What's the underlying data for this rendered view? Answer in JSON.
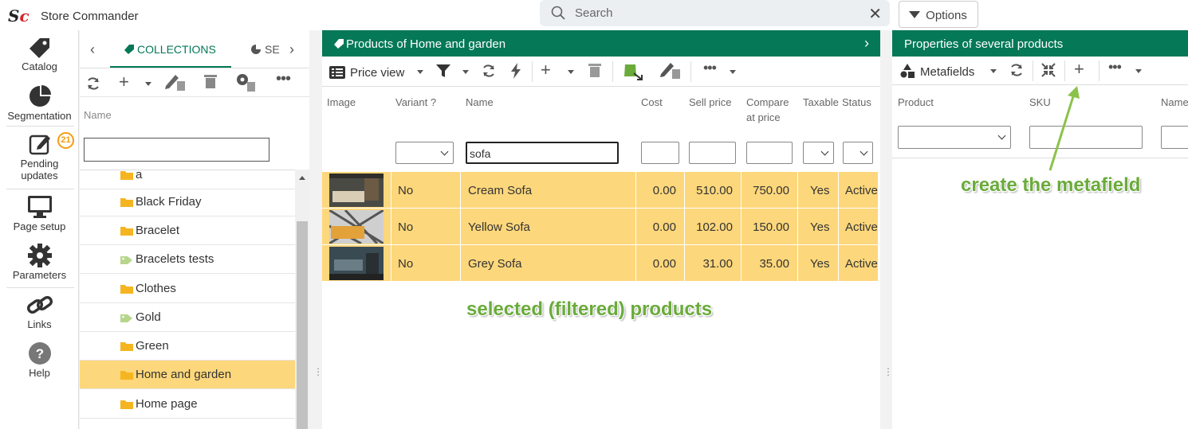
{
  "app": {
    "logo_s": "S",
    "logo_c": "c",
    "title": "Store Commander"
  },
  "search": {
    "placeholder": "Search",
    "close": "✕"
  },
  "options": {
    "label": "Options"
  },
  "nav": {
    "catalog": "Catalog",
    "segmentation": "Segmentation",
    "pending_line1": "Pending",
    "pending_line2": "updates",
    "pending_count": "21",
    "page_setup": "Page setup",
    "parameters": "Parameters",
    "links": "Links",
    "help": "Help"
  },
  "collections_panel": {
    "tab_collections": "COLLECTIONS",
    "tab_segments": "SE",
    "column_name": "Name",
    "items": [
      {
        "label": "a",
        "icon": "folder-icon"
      },
      {
        "label": "Black Friday",
        "icon": "folder-icon"
      },
      {
        "label": "Bracelet",
        "icon": "folder-icon"
      },
      {
        "label": "Bracelets tests",
        "icon": "tag-icon"
      },
      {
        "label": "Clothes",
        "icon": "folder-icon"
      },
      {
        "label": "Gold",
        "icon": "tag-icon"
      },
      {
        "label": "Green",
        "icon": "folder-icon"
      },
      {
        "label": "Home and garden",
        "icon": "folder-icon",
        "selected": true
      },
      {
        "label": "Home page",
        "icon": "folder-icon"
      }
    ]
  },
  "products_panel": {
    "title": "Products of Home and garden",
    "view_label": "Price view",
    "columns": {
      "image": "Image",
      "variant": "Variant ?",
      "name": "Name",
      "cost": "Cost",
      "sell": "Sell price",
      "compare1": "Compare",
      "compare2": "at price",
      "taxable": "Taxable",
      "status": "Status"
    },
    "name_filter": "sofa",
    "rows": [
      {
        "variant": "No",
        "name": "Cream Sofa",
        "cost": "0.00",
        "sell": "510.00",
        "compare": "750.00",
        "taxable": "Yes",
        "status": "Active"
      },
      {
        "variant": "No",
        "name": "Yellow Sofa",
        "cost": "0.00",
        "sell": "102.00",
        "compare": "150.00",
        "taxable": "Yes",
        "status": "Active"
      },
      {
        "variant": "No",
        "name": "Grey Sofa",
        "cost": "0.00",
        "sell": "31.00",
        "compare": "35.00",
        "taxable": "Yes",
        "status": "Active"
      }
    ],
    "annotation": "selected (filtered) products"
  },
  "properties_panel": {
    "title": "Properties of several products",
    "view_label": "Metafields",
    "columns": {
      "product": "Product",
      "sku": "SKU",
      "name": "Name"
    },
    "annotation": "create the metafield"
  },
  "colors": {
    "brand_green": "#047857",
    "selected": "#fdd77b",
    "annotation": "#6aab3a",
    "logo_red": "#d9242a"
  }
}
